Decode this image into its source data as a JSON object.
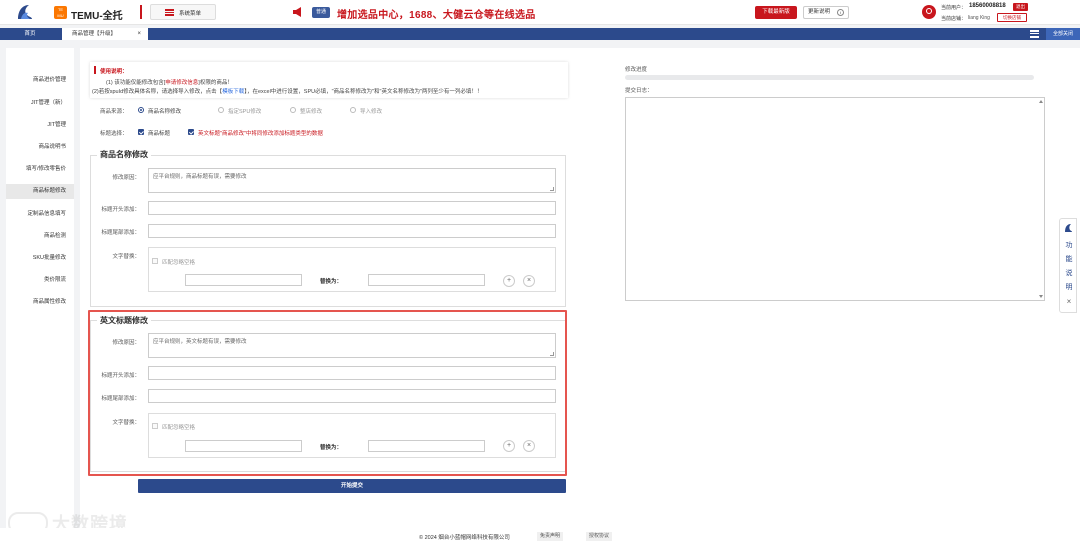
{
  "header": {
    "brand": "TEMU-全托",
    "temu_logo_text": "TEMU",
    "system_menu": "系统菜单",
    "notice_tag": "普通",
    "notice": "增加选品中心，1688、大健云仓等在线选品",
    "download_btn": "下载最新版",
    "update_btn": "更新说明",
    "current_user_label": "当前用户：",
    "phone": "18560008818",
    "logout": "退出",
    "current_store_label": "当前店铺：",
    "store": "liang King",
    "switch_store": "切换店铺"
  },
  "tabs": {
    "home": "首页",
    "active": "商品管理【升级】",
    "close_all": "全部关闭"
  },
  "sidebar": {
    "items": [
      {
        "label": "商品进价管理"
      },
      {
        "label": "JIT管理（新）"
      },
      {
        "label": "JIT管理"
      },
      {
        "label": "商品说明书"
      },
      {
        "label": "填写/修改零售价"
      },
      {
        "label": "商品标题修改"
      },
      {
        "label": "定制品信息填写"
      },
      {
        "label": "商品检测"
      },
      {
        "label": "SKU批量修改"
      },
      {
        "label": "类价限流"
      },
      {
        "label": "商品属性修改"
      }
    ]
  },
  "usage": {
    "title": "使用说明：",
    "line1_a": "(1)  该功能仅能修改包含[",
    "line1_b": "申请修改信息",
    "line1_c": "]权限的商品！",
    "line2_a": "(2)若按spuId修改具体名称，请选择导入修改，点击【",
    "line2_b": "模板下载",
    "line2_c": "】，在excel中进行设置，SPU必填，\"商品名称修改为\"和\"英文名称修改为\"两列至少有一列必填！！"
  },
  "source": {
    "label": "商品来源：",
    "options": [
      "商品名称修改",
      "指定SPU修改",
      "整店修改",
      "导入修改"
    ]
  },
  "title_select": {
    "label": "标题选择：",
    "opt1": "商品标题",
    "opt2": "英文标题\"商品修改\"中将同修改添加标题类型的数据"
  },
  "cn_section": {
    "legend": "商品名称修改",
    "reason_label": "修改原因：",
    "reason_value": "应平台规则，商品标题有误，需要修改",
    "prefix_label": "标题开头添加：",
    "suffix_label": "标题尾部添加：",
    "replace_label": "文字替换：",
    "match_space": "匹配忽略空格",
    "replace_with": "替换为："
  },
  "en_section": {
    "legend": "英文标题修改",
    "reason_label": "修改原因：",
    "reason_value": "应平台规则，英文标题有误，需要修改",
    "prefix_label": "标题开头添加：",
    "suffix_label": "标题尾部添加：",
    "replace_label": "文字替换：",
    "match_space": "匹配忽略空格",
    "replace_with": "替换为："
  },
  "submit": "开始提交",
  "right": {
    "progress_label": "修改进度",
    "progress": 0,
    "log_label": "提交日志："
  },
  "float_tab": {
    "text": "功能说明"
  },
  "footer": {
    "copyright": "© 2024 烟台小蓝帽网络科技有限公司",
    "disclaimer": "免责声明",
    "license": "授权协议"
  },
  "watermark": "大数跨境",
  "colors": {
    "brand_red": "#c8161d",
    "navy": "#2c4a8c",
    "highlight": "#e5554f"
  }
}
